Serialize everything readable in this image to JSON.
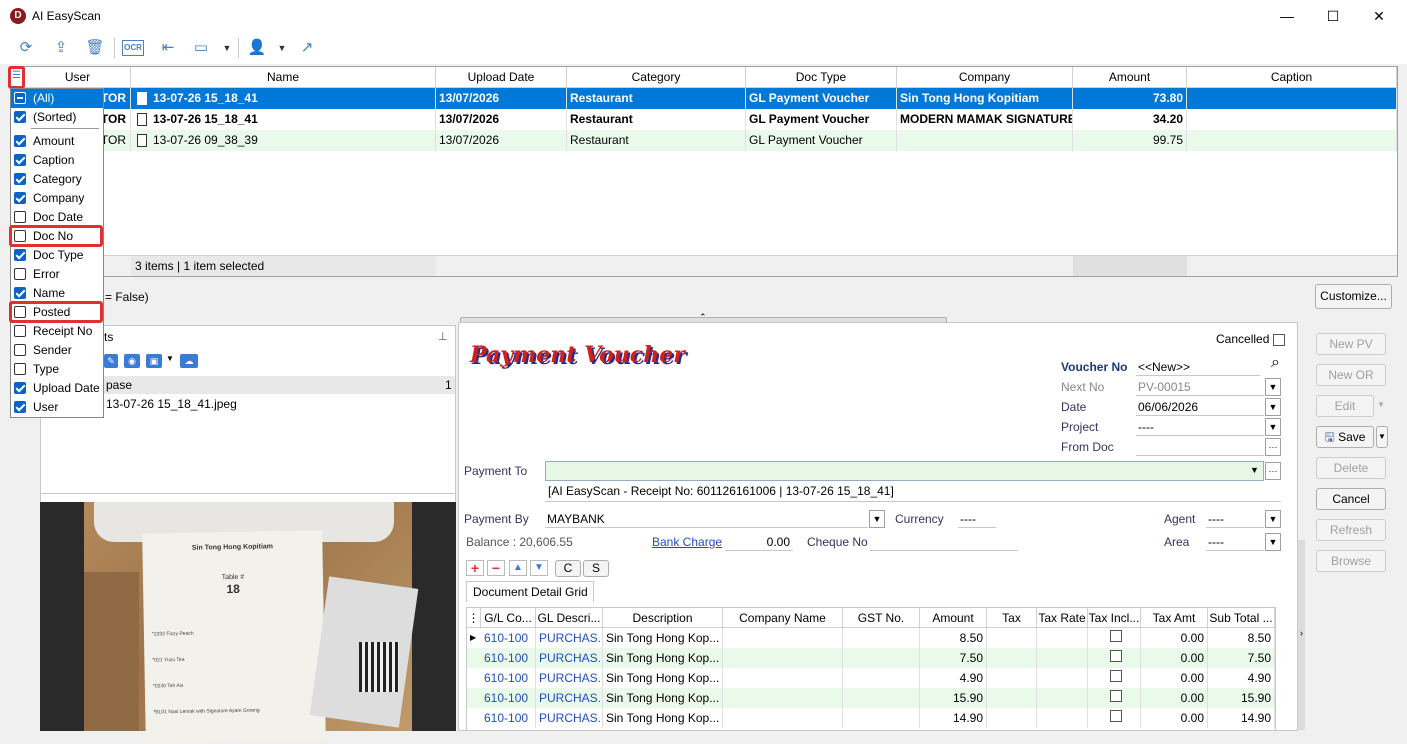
{
  "window": {
    "title": "AI EasyScan",
    "app_icon": "D",
    "minimize": "—",
    "maximize": "☐",
    "close": "✕"
  },
  "toolbar": {
    "icons": [
      "refresh-icon",
      "upload-icon",
      "delete-icon",
      "ocr-icon",
      "panel-icon",
      "layout-icon",
      "dropdown-icon",
      "user-icon",
      "dropdown-icon",
      "share-icon"
    ],
    "ocr": "OCR"
  },
  "grid": {
    "columns": [
      "User",
      "Name",
      "Upload Date",
      "Category",
      "Doc Type",
      "Company",
      "Amount",
      "Caption"
    ],
    "rows": [
      {
        "user": "TOR",
        "name": "13-07-26 15_18_41",
        "upload_date": "13/07/2026",
        "category": "Restaurant",
        "doc_type": "GL Payment Voucher",
        "company": "Sin Tong Hong Kopitiam",
        "amount": "73.80",
        "caption": ""
      },
      {
        "user": "TOR",
        "name": "13-07-26 15_18_41",
        "upload_date": "13/07/2026",
        "category": "Restaurant",
        "doc_type": "GL Payment Voucher",
        "company": "MODERN MAMAK SIGNATURE",
        "amount": "34.20",
        "caption": ""
      },
      {
        "user": "TOR",
        "name": "13-07-26 09_38_39",
        "upload_date": "13/07/2026",
        "category": "Restaurant",
        "doc_type": "GL Payment Voucher",
        "company": "",
        "amount": "99.75",
        "caption": ""
      }
    ],
    "footer": "3 items | 1 item selected",
    "filter_text": "= False)",
    "customize": "Customize..."
  },
  "column_menu": {
    "items": [
      {
        "label": "(All)",
        "state": "partial"
      },
      {
        "label": "(Sorted)",
        "state": "on"
      },
      {
        "label": "Amount",
        "state": "on"
      },
      {
        "label": "Caption",
        "state": "on"
      },
      {
        "label": "Category",
        "state": "on"
      },
      {
        "label": "Company",
        "state": "on"
      },
      {
        "label": "Doc Date",
        "state": "off"
      },
      {
        "label": "Doc No",
        "state": "off"
      },
      {
        "label": "Doc Type",
        "state": "on"
      },
      {
        "label": "Error",
        "state": "off"
      },
      {
        "label": "Name",
        "state": "on"
      },
      {
        "label": "Posted",
        "state": "off"
      },
      {
        "label": "Receipt No",
        "state": "off"
      },
      {
        "label": "Sender",
        "state": "off"
      },
      {
        "label": "Type",
        "state": "off"
      },
      {
        "label": "Upload Date",
        "state": "on"
      },
      {
        "label": "User",
        "state": "on"
      }
    ]
  },
  "attachments": {
    "title_suffix": "ts",
    "col_header": "pase",
    "count": "1",
    "file": "13-07-26 15_18_41.jpeg"
  },
  "receipt": {
    "shop": "Sin Tong Hong Kopitiam",
    "table_label": "Table #",
    "table_no": "18",
    "items": [
      "*2202 Fizzy Peach",
      "*021 Yuzu Tea",
      "*0230 Teh Ais",
      "*BL01 Nasi Lemak with Signature Ayam Goreng"
    ]
  },
  "voucher": {
    "heading": "Payment Voucher",
    "cancelled_label": "Cancelled",
    "voucher_no_label": "Voucher No",
    "voucher_no": "<<New>>",
    "next_no_label": "Next No",
    "next_no": "PV-00015",
    "date_label": "Date",
    "date": "06/06/2026",
    "project_label": "Project",
    "project": "----",
    "from_doc_label": "From Doc",
    "payment_to_label": "Payment To",
    "payment_to": "",
    "description": "[AI EasyScan - Receipt No: 601126161006 | 13-07-26 15_18_41]",
    "payment_by_label": "Payment By",
    "payment_by": "MAYBANK",
    "currency_label": "Currency",
    "currency": "----",
    "agent_label": "Agent",
    "agent": "----",
    "balance": "Balance : 20,606.55",
    "bank_charge_label": "Bank Charge",
    "bank_charge": "0.00",
    "cheque_no_label": "Cheque No",
    "area_label": "Area",
    "area": "----",
    "btn_c": "C",
    "btn_s": "S",
    "tab": "Document Detail Grid"
  },
  "detail": {
    "columns": [
      "G/L Co...",
      "GL Descri...",
      "Description",
      "Company Name",
      "GST No.",
      "Amount",
      "Tax",
      "Tax Rate",
      "Tax Incl...",
      "Tax Amt",
      "Sub Total ..."
    ],
    "rows": [
      {
        "gl": "610-100",
        "gldesc": "PURCHAS...",
        "desc": "Sin Tong Hong Kop...",
        "amount": "8.50",
        "tax_amt": "0.00",
        "subtotal": "8.50"
      },
      {
        "gl": "610-100",
        "gldesc": "PURCHAS...",
        "desc": "Sin Tong Hong Kop...",
        "amount": "7.50",
        "tax_amt": "0.00",
        "subtotal": "7.50"
      },
      {
        "gl": "610-100",
        "gldesc": "PURCHAS...",
        "desc": "Sin Tong Hong Kop...",
        "amount": "4.90",
        "tax_amt": "0.00",
        "subtotal": "4.90"
      },
      {
        "gl": "610-100",
        "gldesc": "PURCHAS...",
        "desc": "Sin Tong Hong Kop...",
        "amount": "15.90",
        "tax_amt": "0.00",
        "subtotal": "15.90"
      },
      {
        "gl": "610-100",
        "gldesc": "PURCHAS...",
        "desc": "Sin Tong Hong Kop...",
        "amount": "14.90",
        "tax_amt": "0.00",
        "subtotal": "14.90"
      }
    ]
  },
  "actions": {
    "new_pv": "New PV",
    "new_or": "New OR",
    "edit": "Edit",
    "save": "Save",
    "delete": "Delete",
    "cancel": "Cancel",
    "refresh": "Refresh",
    "browse": "Browse"
  }
}
